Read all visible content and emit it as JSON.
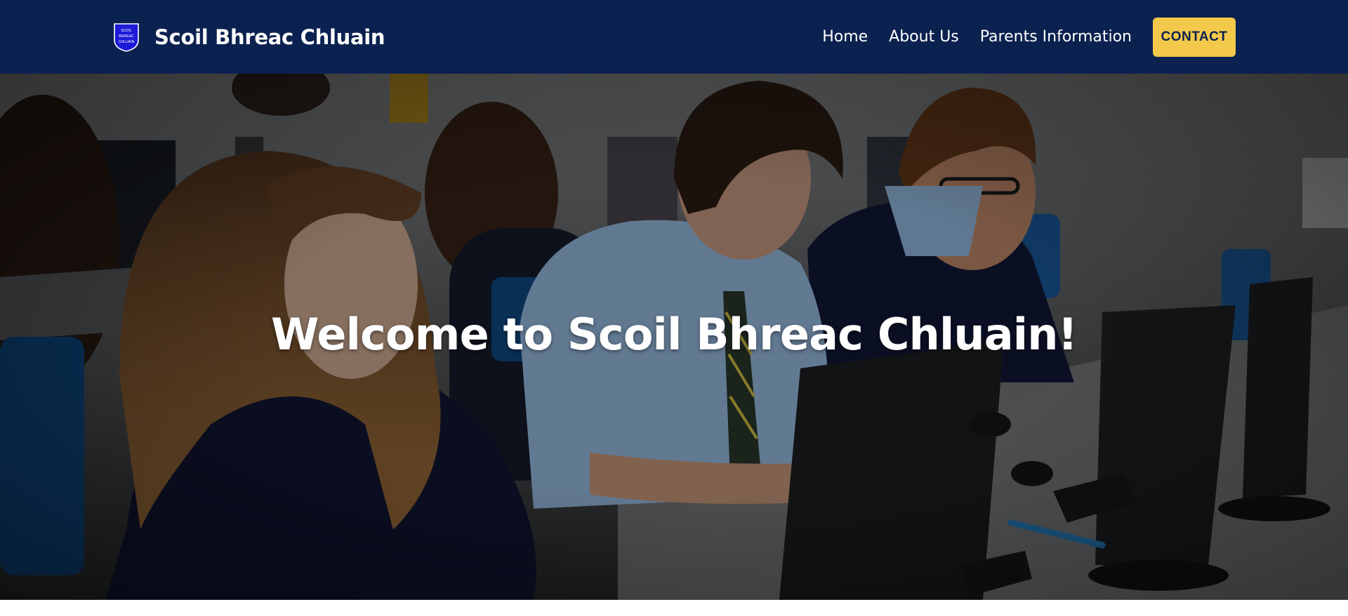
{
  "header": {
    "crest_text": [
      "SCOIL",
      "BHREAC",
      "CHLUAIN"
    ],
    "brand_title": "Scoil Bhreac Chluain",
    "nav": [
      {
        "label": "Home"
      },
      {
        "label": "About Us"
      },
      {
        "label": "Parents Information"
      }
    ],
    "contact_label": "CONTACT"
  },
  "hero": {
    "title": "Welcome to Scoil Bhreac Chluain!",
    "image_icon": "classroom-photo-icon"
  },
  "colors": {
    "navbar_bg": "#0b214f",
    "accent": "#f3c94b",
    "text_light": "#ffffff"
  }
}
